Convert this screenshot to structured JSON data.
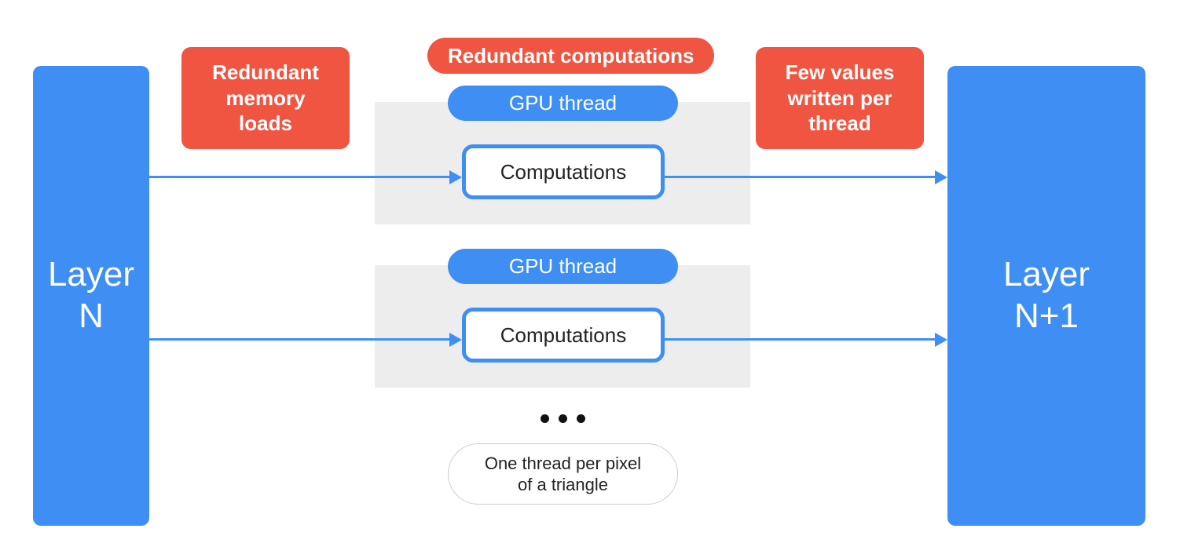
{
  "colors": {
    "blue": "#3E8EF4",
    "red": "#EF5541",
    "grey": "#EDEDED"
  },
  "layer_left": {
    "line1": "Layer",
    "line2": "N"
  },
  "layer_right": {
    "line1": "Layer",
    "line2": "N+1"
  },
  "callout_left": "Redundant memory loads",
  "callout_top_pill": "Redundant computations",
  "callout_right": "Few values written per thread",
  "threads": [
    {
      "pill": "GPU thread",
      "box": "Computations"
    },
    {
      "pill": "GPU thread",
      "box": "Computations"
    }
  ],
  "ellipsis": "…",
  "bottom_pill": {
    "line1": "One thread per pixel",
    "line2": "of a triangle"
  }
}
